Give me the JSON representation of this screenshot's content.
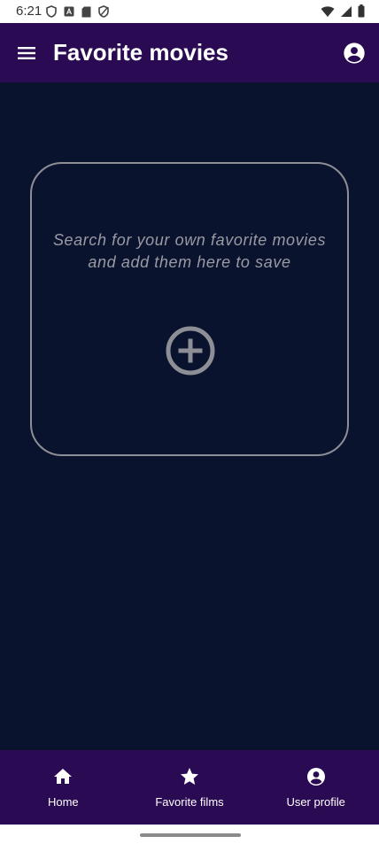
{
  "status_bar": {
    "time": "6:21",
    "left_icons": [
      "shield-icon",
      "a-square-icon",
      "sd-card-icon",
      "shield-icon"
    ],
    "right_icons": [
      "wifi-icon",
      "signal-icon",
      "battery-icon"
    ]
  },
  "app_bar": {
    "title": "Favorite movies",
    "menu_icon": "menu-icon",
    "profile_icon": "account-circle-icon"
  },
  "main": {
    "empty_state": {
      "line1": "Search for your own favorite movies",
      "line2": "and add them here to save",
      "icon": "add-circle-icon"
    }
  },
  "bottom_nav": {
    "items": [
      {
        "label": "Home",
        "icon": "home-icon"
      },
      {
        "label": "Favorite films",
        "icon": "star-icon"
      },
      {
        "label": "User profile",
        "icon": "account-circle-icon"
      }
    ]
  },
  "colors": {
    "app_bar": "#2a0a52",
    "background": "#0a132d",
    "card_border": "#8e8e96",
    "hint_text": "#9a9aa4"
  }
}
